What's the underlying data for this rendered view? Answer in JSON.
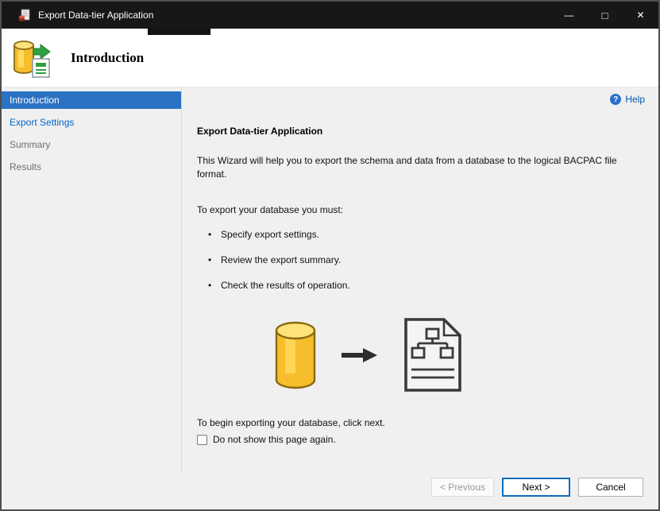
{
  "window": {
    "title": "Export Data-tier Application",
    "controls": {
      "minimize": "—",
      "maximize": "□",
      "close": "✕"
    }
  },
  "header": {
    "title": "Introduction"
  },
  "sidebar": {
    "items": [
      {
        "label": "Introduction",
        "state": "active"
      },
      {
        "label": "Export Settings",
        "state": "enabled-link"
      },
      {
        "label": "Summary",
        "state": "disabled"
      },
      {
        "label": "Results",
        "state": "disabled"
      }
    ]
  },
  "main": {
    "help_label": "Help",
    "help_icon_glyph": "?",
    "heading": "Export Data-tier Application",
    "intro_paragraph": "This Wizard will help you to export the schema and data from a database to the logical BACPAC file format.",
    "requirements_label": "To export your database you must:",
    "bullets": [
      "Specify export settings.",
      "Review the export summary.",
      "Check the results of operation."
    ],
    "begin_text": "To begin exporting your database, click next.",
    "checkbox_label": "Do not show this page again.",
    "checkbox_checked": false
  },
  "footer": {
    "previous_label": "< Previous",
    "next_label": "Next >",
    "cancel_label": "Cancel"
  },
  "colors": {
    "titlebar_bg": "#171717",
    "selected_nav_bg": "#2a72c3",
    "link_blue": "#0066cc",
    "help_blue": "#0157ad",
    "next_button_border": "#0f6cbd",
    "database_yellow": "#f6bd2c"
  }
}
